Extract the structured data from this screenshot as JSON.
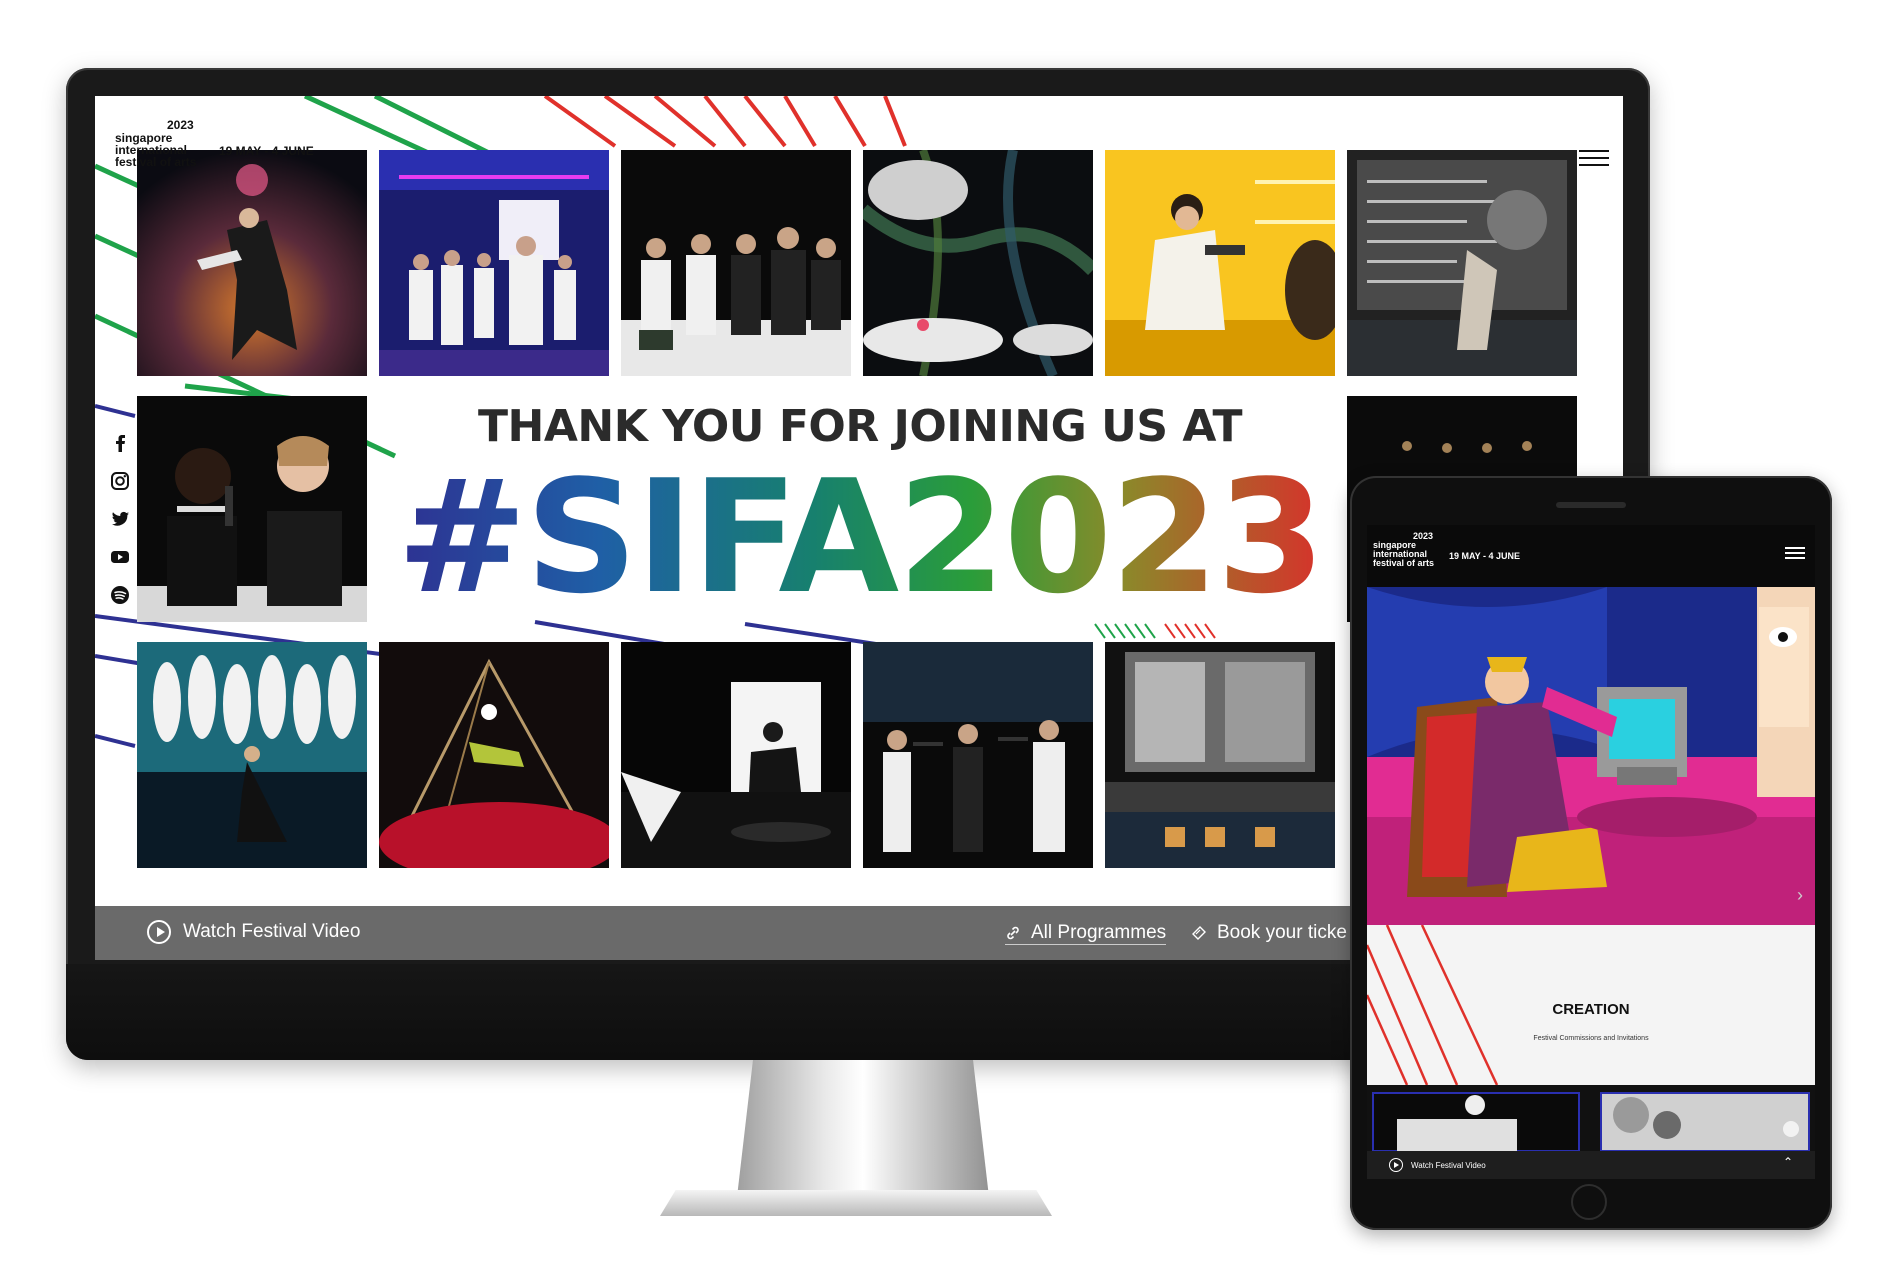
{
  "site": {
    "logo_year": "2023",
    "logo_name": "singapore international festival of arts",
    "dates": "19 MAY - 4 JUNE"
  },
  "social": [
    "facebook-icon",
    "instagram-icon",
    "twitter-icon",
    "youtube-icon",
    "spotify-icon"
  ],
  "headline": {
    "line1": "THANK YOU FOR JOINING US AT",
    "line2": "#SIFA2023"
  },
  "bottom_bar": {
    "watch_label": "Watch Festival Video",
    "programmes_label": "All Programmes",
    "tickets_label": "Book your ticke"
  },
  "tablet": {
    "logo_year": "2023",
    "logo_name": "singapore international festival of arts",
    "dates": "19 MAY - 4 JUNE",
    "section_title": "CREATION",
    "section_sub": "Festival Commissions and Invitations",
    "watch_label": "Watch Festival Video"
  },
  "colors": {
    "stripe_green": "#1fa34a",
    "stripe_red": "#e0312b",
    "stripe_blue": "#2e3192",
    "bottom_bar": "#6a6a6a",
    "tablet_hero_pink": "#e12c92"
  }
}
